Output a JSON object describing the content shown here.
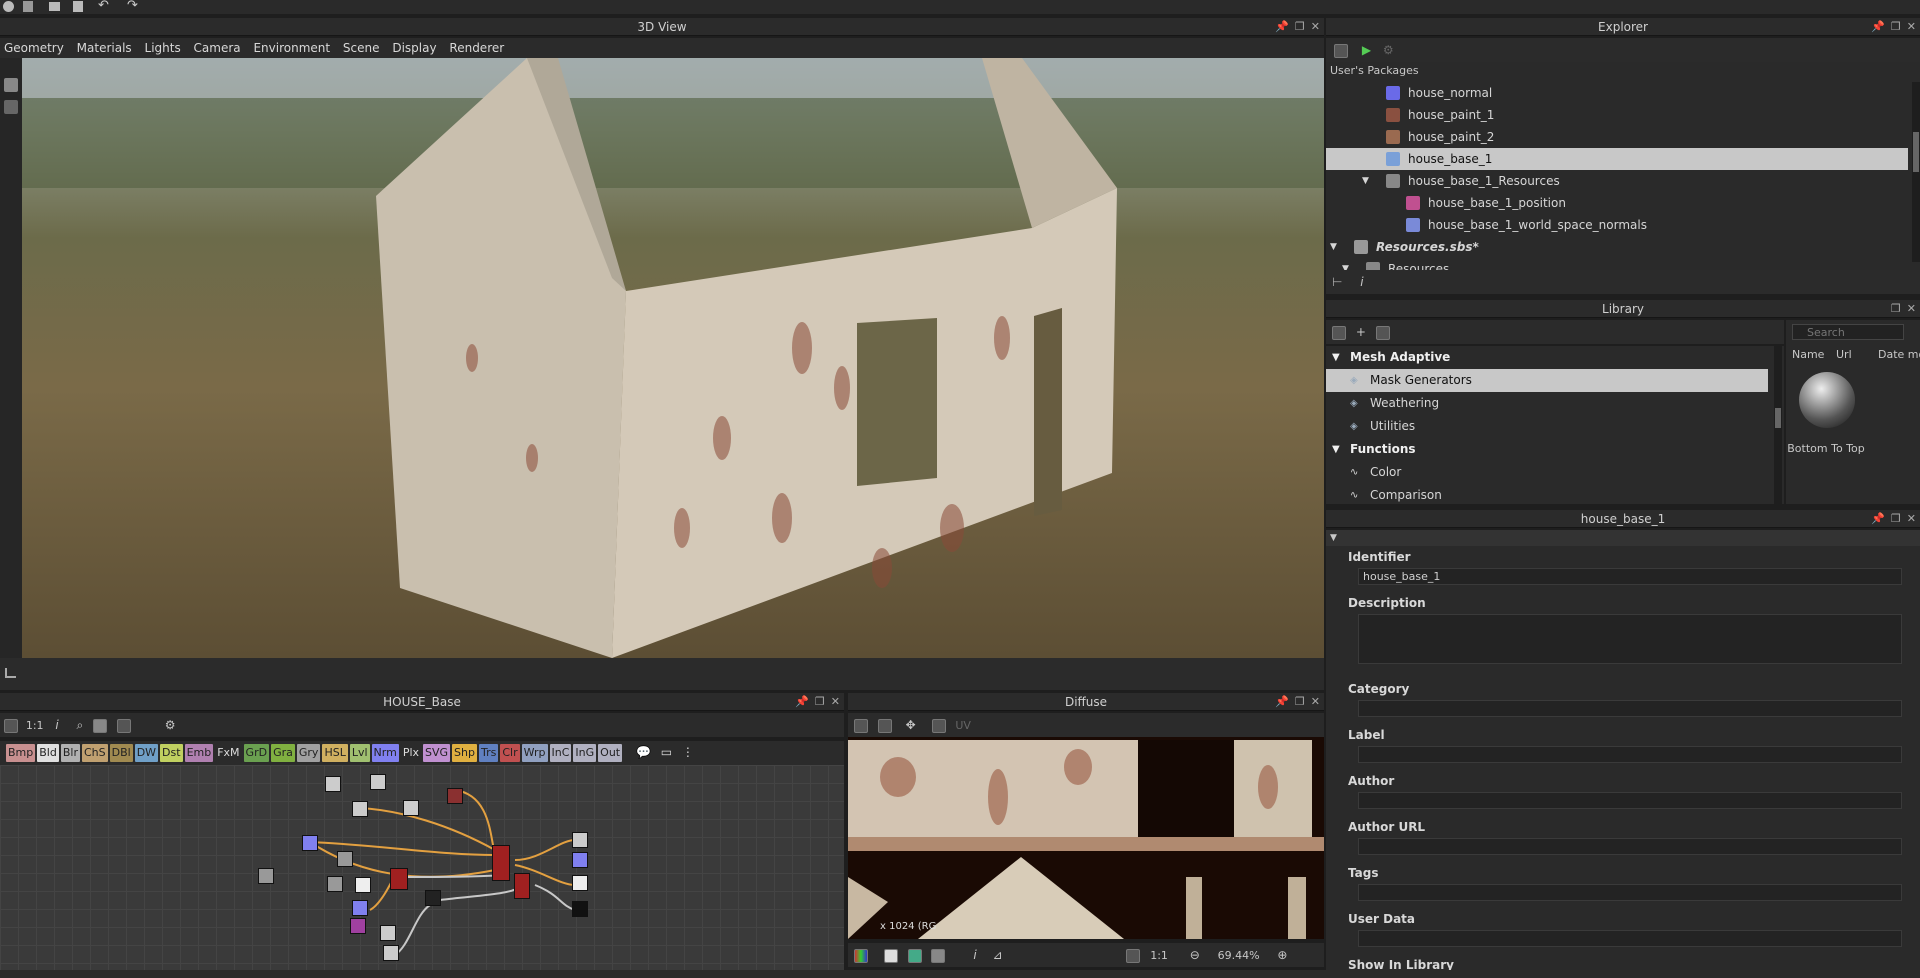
{
  "app": {
    "top_toolbar_icons": [
      "app-logo-icon",
      "new-icon",
      "open-icon",
      "save-icon",
      "save-all-icon",
      "undo-icon",
      "redo-icon"
    ]
  },
  "view3d": {
    "title": "3D View",
    "menu": [
      "Geometry",
      "Materials",
      "Lights",
      "Camera",
      "Environment",
      "Scene",
      "Display",
      "Renderer"
    ]
  },
  "explorer": {
    "title": "Explorer",
    "section": "User's Packages",
    "items": [
      {
        "label": "house_normal",
        "icon_color": "#6a6ae8"
      },
      {
        "label": "house_paint_1",
        "icon_color": "#8a5040"
      },
      {
        "label": "house_paint_2",
        "icon_color": "#9a6a50"
      },
      {
        "label": "house_base_1",
        "icon_color": "#7aa0d8",
        "selected": true
      },
      {
        "label": "house_base_1_Resources",
        "icon_color": "#888888",
        "expanded": true
      },
      {
        "label": "house_base_1_position",
        "icon_color": "#c05090"
      },
      {
        "label": "house_base_1_world_space_normals",
        "icon_color": "#7a8ad8"
      },
      {
        "label": "Resources.sbs*",
        "icon_color": "#999999",
        "bold_italic": true
      },
      {
        "label": "Resources",
        "icon_color": "#888888"
      }
    ]
  },
  "library": {
    "title": "Library",
    "search_placeholder": "Search",
    "columns": [
      "Name",
      "Url",
      "Date mo"
    ],
    "tree": [
      {
        "label": "Mesh Adaptive",
        "type": "header"
      },
      {
        "label": "Mask Generators",
        "type": "item",
        "selected": true
      },
      {
        "label": "Weathering",
        "type": "item"
      },
      {
        "label": "Utilities",
        "type": "item"
      },
      {
        "label": "Functions",
        "type": "header"
      },
      {
        "label": "Color",
        "type": "func"
      },
      {
        "label": "Comparison",
        "type": "func"
      }
    ],
    "preview_label": "Bottom To Top"
  },
  "properties": {
    "title": "house_base_1",
    "fields": [
      {
        "label": "Identifier",
        "value": "house_base_1"
      },
      {
        "label": "Description",
        "value": ""
      },
      {
        "label": "Category",
        "value": ""
      },
      {
        "label": "Label",
        "value": ""
      },
      {
        "label": "Author",
        "value": ""
      },
      {
        "label": "Author URL",
        "value": ""
      },
      {
        "label": "Tags",
        "value": ""
      },
      {
        "label": "User Data",
        "value": ""
      },
      {
        "label": "Show In Library",
        "value": ""
      }
    ]
  },
  "graph": {
    "title": "HOUSE_Base",
    "zoom_label": "1:1",
    "chips": [
      {
        "label": "Bmp",
        "color": "#c89090"
      },
      {
        "label": "Bld",
        "color": "#e0e0e0"
      },
      {
        "label": "Blr",
        "color": "#b0b0b0"
      },
      {
        "label": "ChS",
        "color": "#c0a070"
      },
      {
        "label": "DBl",
        "color": "#a08a50"
      },
      {
        "label": "DW",
        "color": "#70a0c8"
      },
      {
        "label": "Dst",
        "color": "#c0d060"
      },
      {
        "label": "Emb",
        "color": "#b080b0"
      },
      {
        "label": "FxM",
        "color": "#2b2b2b"
      },
      {
        "label": "GrD",
        "color": "#6aa050"
      },
      {
        "label": "Gra",
        "color": "#80b040"
      },
      {
        "label": "Gry",
        "color": "#a0a0a0"
      },
      {
        "label": "HSL",
        "color": "#d0b060"
      },
      {
        "label": "Lvl",
        "color": "#a0c070"
      },
      {
        "label": "Nrm",
        "color": "#8080f0"
      },
      {
        "label": "Plx",
        "color": "#2b2b2b"
      },
      {
        "label": "SVG",
        "color": "#c090d0"
      },
      {
        "label": "Shp",
        "color": "#e0b040"
      },
      {
        "label": "Trs",
        "color": "#6080c0"
      },
      {
        "label": "Clr",
        "color": "#c05050"
      },
      {
        "label": "Wrp",
        "color": "#90a0c0"
      },
      {
        "label": "InC",
        "color": "#b0b0c0"
      },
      {
        "label": "InG",
        "color": "#b0b0c0"
      },
      {
        "label": "Out",
        "color": "#b0b0c0"
      }
    ]
  },
  "diffuse": {
    "title": "Diffuse",
    "uv_label": "UV",
    "info_text": "x 1024 (RG",
    "zoom_ratio": "1:1",
    "zoom_percent": "69.44%"
  }
}
